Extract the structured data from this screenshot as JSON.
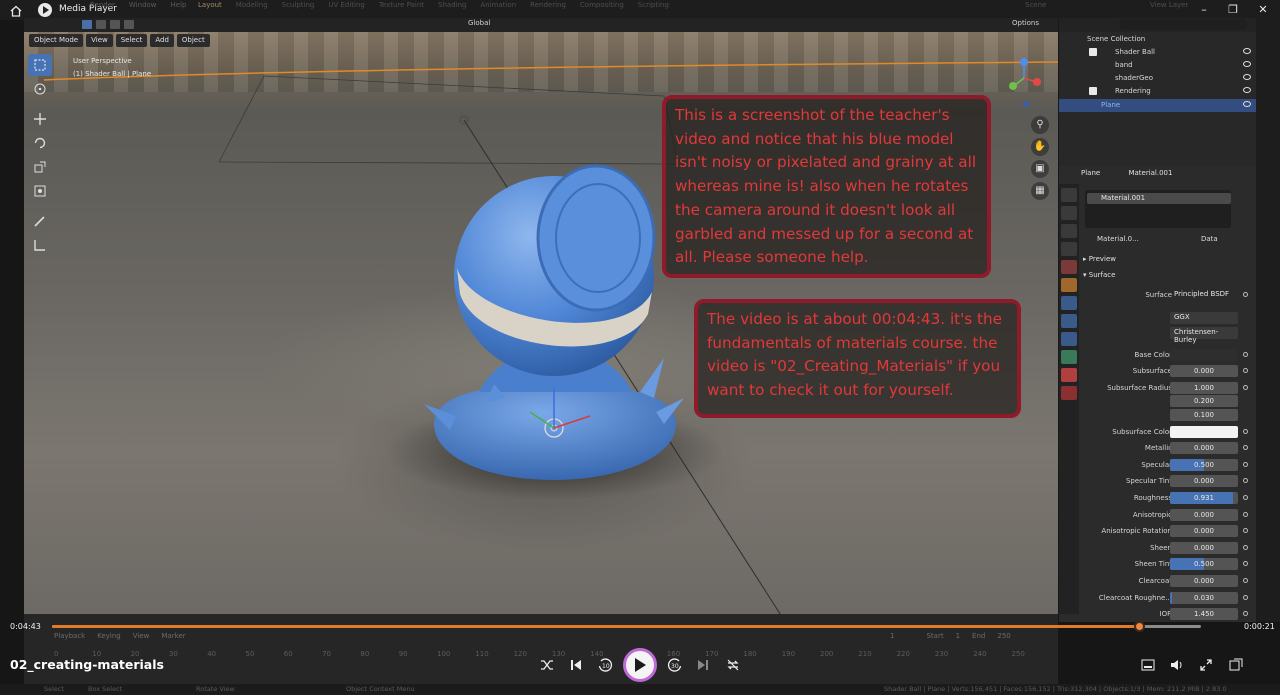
{
  "player": {
    "title": "Media Player",
    "file_name": "02_creating-materials",
    "current_time": "0:04:43",
    "remaining_time": "0:00:21",
    "progress_fraction": 0.946,
    "accent_color": "#e27a2e"
  },
  "blender": {
    "ghost_menu": [
      "Render",
      "Window",
      "Help"
    ],
    "workspace_tabs": [
      "Layout",
      "Modeling",
      "Sculpting",
      "UV Editing",
      "Texture Paint",
      "Shading",
      "Animation",
      "Rendering",
      "Compositing",
      "Scripting"
    ],
    "scene_label": "Scene",
    "view_layer_label": "View Layer",
    "transform_orientation": "Global",
    "options_label": "Options",
    "viewport_menu": {
      "mode": "Object Mode",
      "view": "View",
      "select": "Select",
      "add": "Add",
      "object": "Object"
    },
    "viewport_info": {
      "perspective": "User Perspective",
      "selection": "(1) Shader Ball | Plane"
    },
    "outliner": {
      "items": [
        {
          "label": "Scene Collection"
        },
        {
          "label": "Shader Ball"
        },
        {
          "label": "band"
        },
        {
          "label": "shaderGeo"
        },
        {
          "label": "Rendering"
        },
        {
          "label": "Plane"
        }
      ]
    },
    "properties": {
      "object_name": "Plane",
      "material_name": "Material.001",
      "slot_name": "Material.001",
      "material_short": "Material.0...",
      "data_label": "Data",
      "preview_label": "Preview",
      "surface_section": "Surface",
      "surface_label": "Surface",
      "surface_shader": "Principled BSDF",
      "distribution": "GGX",
      "subsurface_method": "Christensen-Burley",
      "rows": [
        {
          "label": "Base Color",
          "value": "",
          "fill": 0
        },
        {
          "label": "Subsurface",
          "value": "0.000",
          "fill": 0
        },
        {
          "label": "Subsurface Radius",
          "value": "1.000",
          "fill": 0
        },
        {
          "label": "",
          "value": "0.200",
          "fill": 0
        },
        {
          "label": "",
          "value": "0.100",
          "fill": 0
        },
        {
          "label": "Subsurface Color",
          "value": "",
          "fill": 0
        },
        {
          "label": "Metallic",
          "value": "0.000",
          "fill": 0
        },
        {
          "label": "Specular",
          "value": "0.500",
          "fill": 0.5
        },
        {
          "label": "Specular Tint",
          "value": "0.000",
          "fill": 0
        },
        {
          "label": "Roughness",
          "value": "0.931",
          "fill": 0.931
        },
        {
          "label": "Anisotropic",
          "value": "0.000",
          "fill": 0
        },
        {
          "label": "Anisotropic Rotation",
          "value": "0.000",
          "fill": 0
        },
        {
          "label": "Sheen",
          "value": "0.000",
          "fill": 0
        },
        {
          "label": "Sheen Tint",
          "value": "0.500",
          "fill": 0.5
        },
        {
          "label": "Clearcoat",
          "value": "0.000",
          "fill": 0
        },
        {
          "label": "Clearcoat Roughne...",
          "value": "0.030",
          "fill": 0.03
        },
        {
          "label": "IOR",
          "value": "1.450",
          "fill": 0
        }
      ]
    },
    "timeline": {
      "menus": [
        "Playback",
        "Keying",
        "View",
        "Marker"
      ],
      "frame": "1",
      "start_label": "Start",
      "start": "1",
      "end_label": "End",
      "end": "250",
      "ruler": [
        "0",
        "10",
        "20",
        "30",
        "40",
        "50",
        "60",
        "70",
        "80",
        "90",
        "100",
        "110",
        "120",
        "130",
        "140",
        "150",
        "160",
        "170",
        "180",
        "190",
        "200",
        "210",
        "220",
        "230",
        "240",
        "250"
      ]
    },
    "status": {
      "left": [
        "Select",
        "Box Select",
        "Rotate View",
        "Object Context Menu"
      ],
      "right": "Shader Ball | Plane | Verts:156,451 | Faces:156,152 | Tris:312,304 | Objects:1/3 | Mem: 211.2 MiB | 2.83.0"
    }
  },
  "annotations": {
    "note1": "This is a screenshot of the teacher's video and notice that his blue model isn't noisy or pixelated and grainy at all whereas mine is! also when he rotates the camera around it doesn't look all garbled and messed up for a second at all. Please someone help.",
    "note2": "The video is at about 00:04:43. it's the fundamentals of materials course. the video is \"02_Creating_Materials\" if you want to check it out for yourself.",
    "note_text_color": "#e23838",
    "note_border_color": "#8e1a2a"
  },
  "colors": {
    "model_blue": "#4f86d6",
    "selection_blue": "#4772b3",
    "play_ring": "#c06ad8"
  },
  "icons": {
    "home": "home-icon",
    "shuffle": "shuffle-icon",
    "previous": "skip-previous-icon",
    "rewind": "rewind-10-icon",
    "play": "play-icon",
    "forward": "forward-30-icon",
    "next": "skip-next-icon",
    "repeat": "repeat-off-icon",
    "miniplayer": "miniplayer-icon",
    "volume": "volume-icon",
    "fullscreen": "fullscreen-icon",
    "more": "more-icon"
  }
}
